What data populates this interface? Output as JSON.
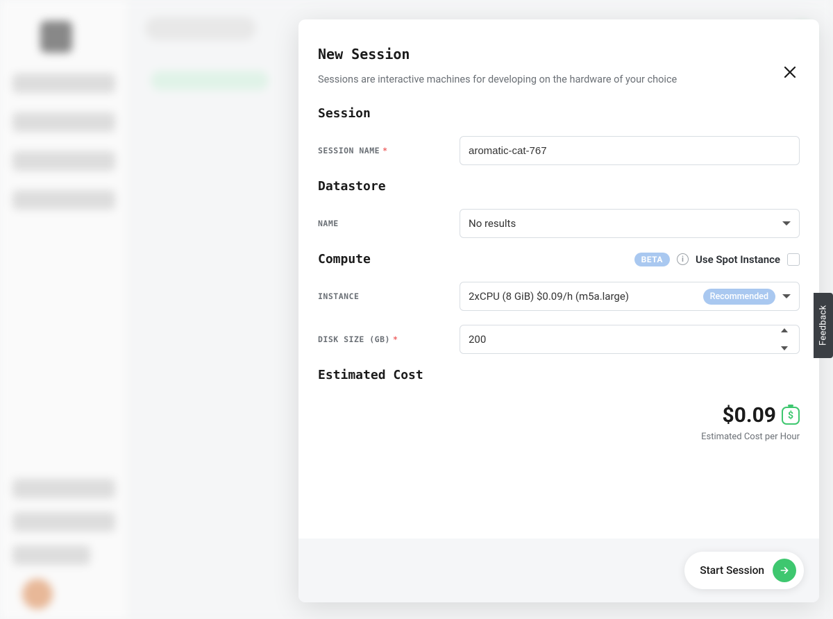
{
  "modal": {
    "title": "New Session",
    "subtitle": "Sessions are interactive machines for developing on the hardware of your choice",
    "sections": {
      "session": {
        "heading": "Session",
        "name_label": "SESSION NAME",
        "name_value": "aromatic-cat-767"
      },
      "datastore": {
        "heading": "Datastore",
        "name_label": "NAME",
        "name_value": "No results"
      },
      "compute": {
        "heading": "Compute",
        "beta_badge": "BETA",
        "spot_label": "Use Spot Instance",
        "spot_checked": false,
        "instance_label": "INSTANCE",
        "instance_value": "2xCPU (8 GiB) $0.09/h (m5a.large)",
        "instance_badge": "Recommended",
        "disk_label": "DISK SIZE (GB)",
        "disk_value": "200"
      },
      "cost": {
        "heading": "Estimated Cost",
        "value": "$0.09",
        "sub": "Estimated Cost per Hour"
      }
    },
    "footer": {
      "start_label": "Start Session"
    }
  },
  "feedback_label": "Feedback"
}
